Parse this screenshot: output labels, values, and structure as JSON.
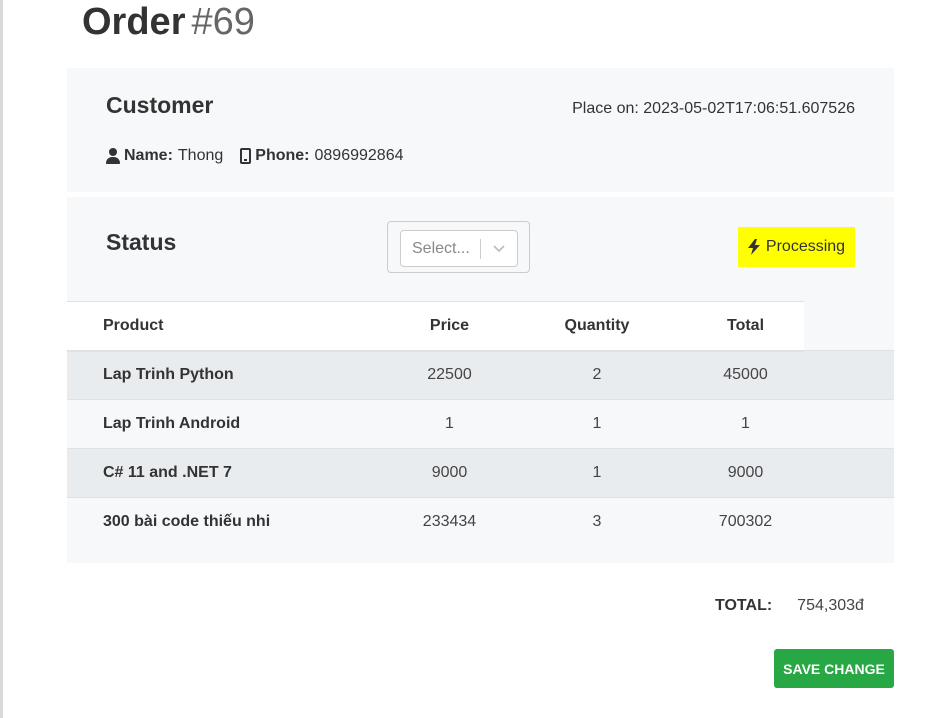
{
  "header": {
    "title": "Order",
    "order_number": "#69"
  },
  "customer": {
    "title": "Customer",
    "placed_on": "Place on: 2023-05-02T17:06:51.607526",
    "name_label": "Name:",
    "name_value": "Thong",
    "phone_label": "Phone:",
    "phone_value": "0896992864"
  },
  "status": {
    "title": "Status",
    "select_placeholder": "Select...",
    "badge_label": "Processing",
    "badge_color": "#ffff00"
  },
  "table": {
    "columns": [
      "Product",
      "Price",
      "Quantity",
      "Total"
    ],
    "rows": [
      {
        "product": "Lap Trinh Python",
        "price": "22500",
        "quantity": "2",
        "total": "45000"
      },
      {
        "product": "Lap Trinh Android",
        "price": "1",
        "quantity": "1",
        "total": "1"
      },
      {
        "product": "C# 11 and .NET 7",
        "price": "9000",
        "quantity": "1",
        "total": "9000"
      },
      {
        "product": "300 bài code thiếu nhi",
        "price": "233434",
        "quantity": "3",
        "total": "700302"
      }
    ]
  },
  "summary": {
    "total_label": "TOTAL:",
    "total_value": "754,303đ"
  },
  "actions": {
    "save_label": "SAVE CHANGE",
    "save_color": "#28a745"
  },
  "icons": {
    "name_icon": "user-icon",
    "phone_icon": "mobile-phone-icon",
    "badge_icon": "bolt-icon",
    "select_icon": "chevron-down-icon"
  }
}
